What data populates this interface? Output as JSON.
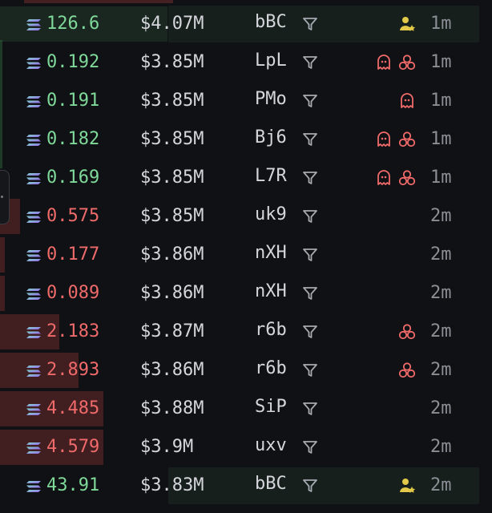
{
  "colors": {
    "background": "#101114",
    "buy": "#7fd99a",
    "sell": "#ef6a6a",
    "text": "#d4d6db",
    "muted": "#8b8e95",
    "badge_red": "#ef6a6a",
    "badge_yellow": "#e2c94a"
  },
  "icons": {
    "coin": "solana-stack-icon",
    "filter": "filter-funnel-icon",
    "ghost": "ghost-icon",
    "bundle": "bundle-cluster-icon",
    "dev": "dev-user-star-icon"
  },
  "rows": [
    {
      "side": "buy",
      "amount": "126.6",
      "mcap": "$4.07M",
      "maker": "bBC",
      "badges": [
        "dev"
      ],
      "age": "1m",
      "bar_level": 0.34,
      "highlight": true
    },
    {
      "side": "buy",
      "amount": "0.192",
      "mcap": "$3.85M",
      "maker": "LpL",
      "badges": [
        "ghost",
        "bundle"
      ],
      "age": "1m",
      "bar_level": 0.0
    },
    {
      "side": "buy",
      "amount": "0.191",
      "mcap": "$3.85M",
      "maker": "PMo",
      "badges": [
        "ghost"
      ],
      "age": "1m",
      "bar_level": 0.0
    },
    {
      "side": "buy",
      "amount": "0.182",
      "mcap": "$3.85M",
      "maker": "Bj6",
      "badges": [
        "ghost",
        "bundle"
      ],
      "age": "1m",
      "bar_level": 0.0
    },
    {
      "side": "buy",
      "amount": "0.169",
      "mcap": "$3.85M",
      "maker": "L7R",
      "badges": [
        "ghost",
        "bundle"
      ],
      "age": "1m",
      "bar_level": 0.0
    },
    {
      "side": "sell",
      "amount": "0.575",
      "mcap": "$3.85M",
      "maker": "uk9",
      "badges": [],
      "age": "2m",
      "bar_level": 0.04
    },
    {
      "side": "sell",
      "amount": "0.177",
      "mcap": "$3.86M",
      "maker": "nXH",
      "badges": [],
      "age": "2m",
      "bar_level": 0.01
    },
    {
      "side": "sell",
      "amount": "0.089",
      "mcap": "$3.86M",
      "maker": "nXH",
      "badges": [],
      "age": "2m",
      "bar_level": 0.01
    },
    {
      "side": "sell",
      "amount": "2.183",
      "mcap": "$3.87M",
      "maker": "r6b",
      "badges": [
        "bundle"
      ],
      "age": "2m",
      "bar_level": 0.12
    },
    {
      "side": "sell",
      "amount": "2.893",
      "mcap": "$3.86M",
      "maker": "r6b",
      "badges": [
        "bundle"
      ],
      "age": "2m",
      "bar_level": 0.16
    },
    {
      "side": "sell",
      "amount": "4.485",
      "mcap": "$3.88M",
      "maker": "SiP",
      "badges": [],
      "age": "2m",
      "bar_level": 0.21
    },
    {
      "side": "sell",
      "amount": "4.579",
      "mcap": "$3.9M",
      "maker": "uxv",
      "badges": [],
      "age": "2m",
      "bar_level": 0.21
    },
    {
      "side": "buy",
      "amount": "43.91",
      "mcap": "$3.83M",
      "maker": "bBC",
      "badges": [
        "dev"
      ],
      "age": "2m",
      "bar_level": 0.0,
      "highlight": true
    }
  ]
}
